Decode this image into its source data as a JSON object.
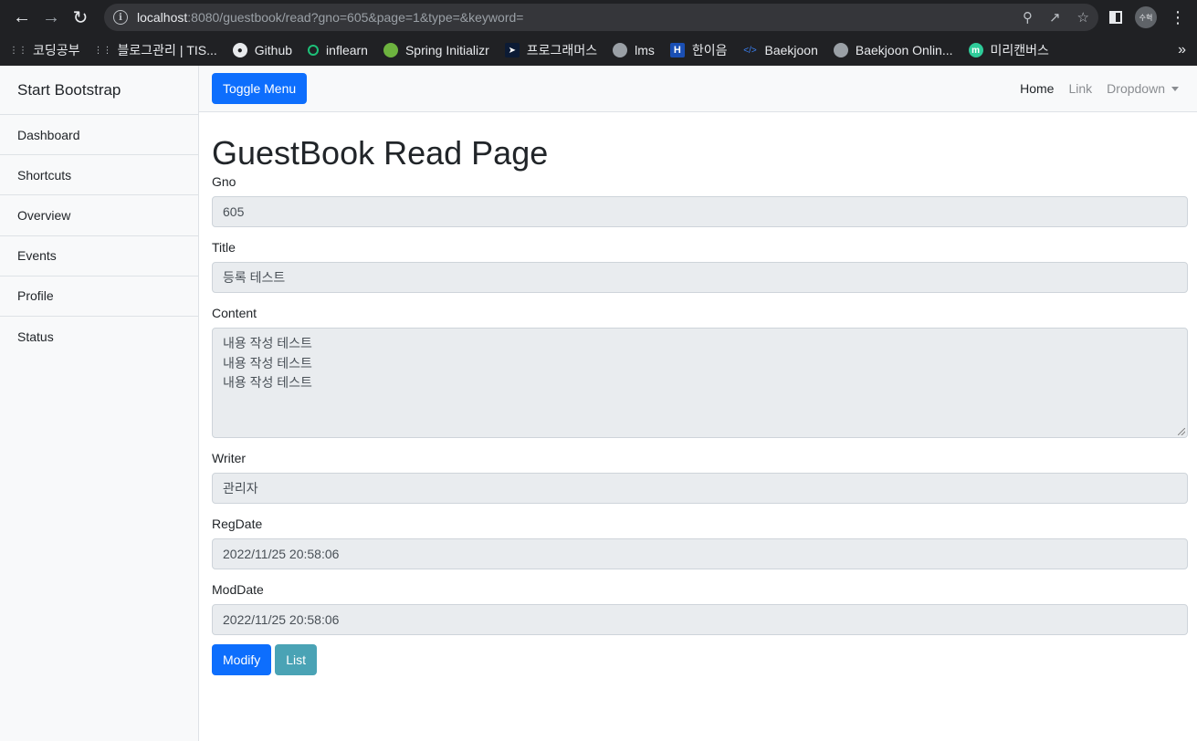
{
  "browser": {
    "url_host": "localhost",
    "url_path": ":8080/guestbook/read?gno=605&page=1&type=&keyword=",
    "profile_label": "수혁",
    "bookmarks": [
      {
        "label": "코딩공부",
        "icon": "tree-icon"
      },
      {
        "label": "블로그관리 | TIS...",
        "icon": "tree-icon"
      },
      {
        "label": "Github",
        "icon": "github-icon"
      },
      {
        "label": "inflearn",
        "icon": "inflearn-icon"
      },
      {
        "label": "Spring Initializr",
        "icon": "spring-icon"
      },
      {
        "label": "프로그래머스",
        "icon": "programmers-icon"
      },
      {
        "label": "lms",
        "icon": "globe-icon"
      },
      {
        "label": "한이음",
        "icon": "h-icon"
      },
      {
        "label": "Baekjoon",
        "icon": "code-icon"
      },
      {
        "label": "Baekjoon Onlin...",
        "icon": "globe-icon"
      },
      {
        "label": "미리캔버스",
        "icon": "m-icon"
      }
    ],
    "more": "»"
  },
  "sidebar": {
    "heading": "Start Bootstrap",
    "items": [
      {
        "label": "Dashboard"
      },
      {
        "label": "Shortcuts"
      },
      {
        "label": "Overview"
      },
      {
        "label": "Events"
      },
      {
        "label": "Profile"
      },
      {
        "label": "Status"
      }
    ]
  },
  "topnav": {
    "toggle_label": "Toggle Menu",
    "home": "Home",
    "link": "Link",
    "dropdown": "Dropdown"
  },
  "main": {
    "title": "GuestBook Read Page",
    "fields": {
      "gno_label": "Gno",
      "gno_value": "605",
      "title_label": "Title",
      "title_value": "등록 테스트",
      "content_label": "Content",
      "content_value": "내용 작성 테스트\n내용 작성 테스트\n내용 작성 테스트",
      "writer_label": "Writer",
      "writer_value": "관리자",
      "regdate_label": "RegDate",
      "regdate_value": "2022/11/25 20:58:06",
      "moddate_label": "ModDate",
      "moddate_value": "2022/11/25 20:58:06"
    },
    "modify_label": "Modify",
    "list_label": "List"
  },
  "colors": {
    "primary": "#0d6efd",
    "info": "#4aa3b5",
    "chrome_bg": "#202124"
  }
}
